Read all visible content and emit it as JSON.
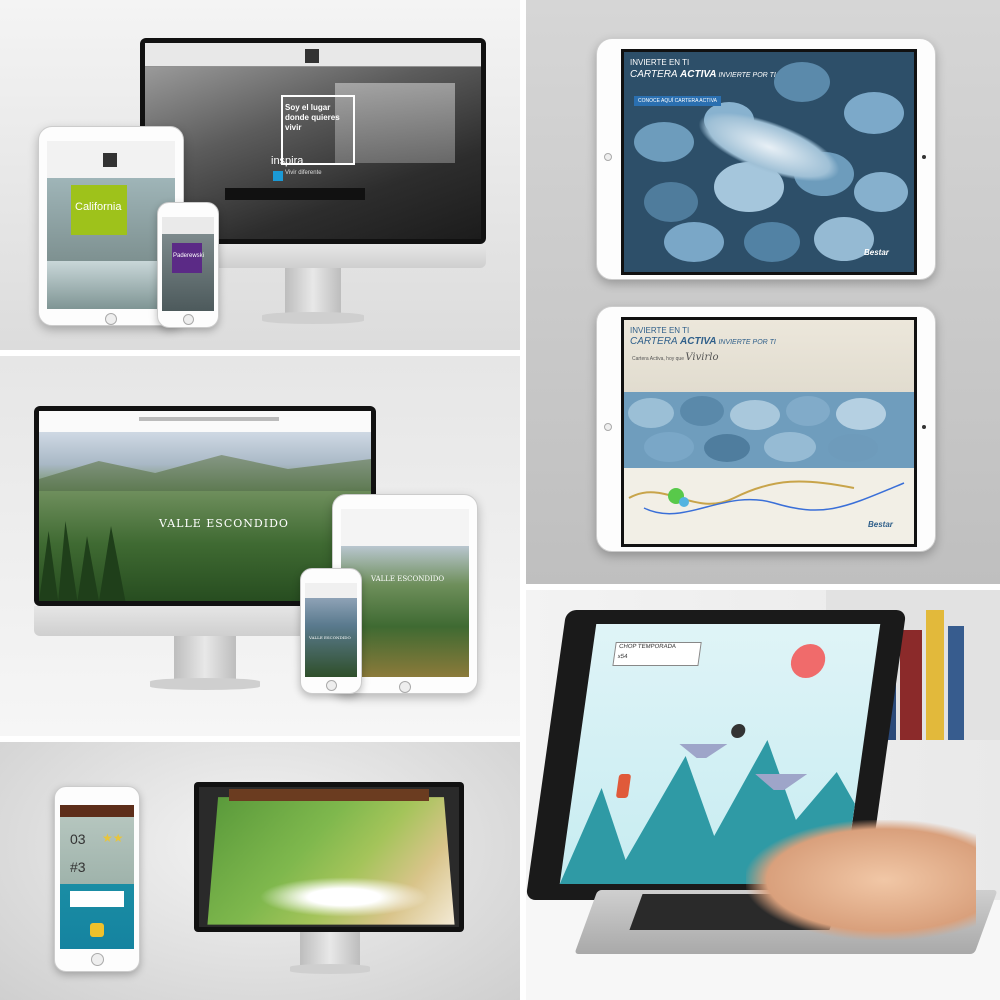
{
  "panels": {
    "inspira": {
      "desktop_headline": "Soy el lugar donde quieres vivir",
      "desktop_brand": "inspira",
      "desktop_cta": "Vivir diferente",
      "tablet_project": "California",
      "phone_project": "Paderewski"
    },
    "valle": {
      "desktop_logo": "VALLE ESCONDIDO",
      "tablet_logo": "VALLE ESCONDIDO",
      "phone_logo": "VALLE ESCONDIDO"
    },
    "cartera_top": {
      "line1": "INVIERTE EN TI",
      "line2_a": "CARTERA ",
      "line2_b": "ACTIVA",
      "line2_c": " INVIERTE POR TI",
      "cta": "CONOCE AQUÍ CARTERA ACTIVA",
      "brand": "Bestar"
    },
    "cartera_bottom": {
      "line1": "INVIERTE EN TI",
      "line2_a": "CARTERA ",
      "line2_b": "ACTIVA",
      "line2_c": " INVIERTE POR TI",
      "line3": "Cartera Activa, hoy que ",
      "line3_script": "Vivirlo",
      "brand": "Bestar"
    },
    "game_mobile": {
      "score_a": "03",
      "score_b": "#3"
    },
    "laptop_game": {
      "hud_label": "CHOP TEMPORADA",
      "hud_count": "x54"
    }
  },
  "colors": {
    "bg_gray": "#d9d9d9",
    "lime": "#9ec21b",
    "purple": "#5b2a86",
    "stone_blue": "#5f8fae",
    "mountain_teal": "#2f9aa5",
    "sun_red": "#f06b6b"
  }
}
